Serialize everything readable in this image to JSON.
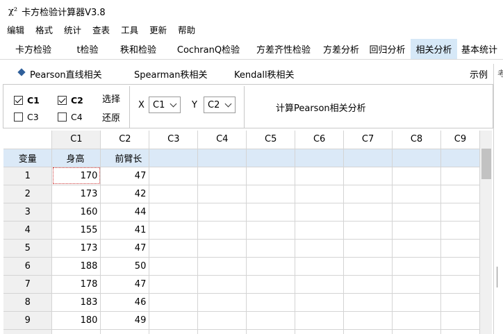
{
  "window": {
    "icon_glyph": "χ²",
    "title": "卡方检验计算器V3.8"
  },
  "menu": [
    "编辑",
    "格式",
    "统计",
    "查表",
    "工具",
    "更新",
    "帮助"
  ],
  "tabs": [
    {
      "label": "卡方检验"
    },
    {
      "label": "t检验"
    },
    {
      "label": "秩和检验"
    },
    {
      "label": "CochranQ检验"
    },
    {
      "label": "方差齐性检验"
    },
    {
      "label": "方差分析"
    },
    {
      "label": "回归分析"
    },
    {
      "label": "相关分析",
      "active": true
    },
    {
      "label": "基本统计"
    }
  ],
  "subtabs": {
    "pearson": "Pearson直线相关",
    "spearman": "Spearman秩相关",
    "kendall": "Kendall秩相关",
    "example": "示例"
  },
  "right_edge_char": "考",
  "columns_panel": {
    "c1": {
      "label": "C1",
      "checked": true
    },
    "c2": {
      "label": "C2",
      "checked": true
    },
    "c3": {
      "label": "C3",
      "checked": false
    },
    "c4": {
      "label": "C4",
      "checked": false
    },
    "select_label": "选择",
    "reset_label": "还原"
  },
  "xy": {
    "x_label": "X",
    "x_value": "C1",
    "y_label": "Y",
    "y_value": "C2"
  },
  "compute_button": "计算Pearson相关分析",
  "grid": {
    "headers": [
      "C1",
      "C2",
      "C3",
      "C4",
      "C5",
      "C6",
      "C7",
      "C8",
      "C9"
    ],
    "var_row": {
      "label": "变量",
      "c1": "身高",
      "c2": "前臂长"
    },
    "rows": [
      {
        "n": "1",
        "c1": "170",
        "c2": "47"
      },
      {
        "n": "2",
        "c1": "173",
        "c2": "42"
      },
      {
        "n": "3",
        "c1": "160",
        "c2": "44"
      },
      {
        "n": "4",
        "c1": "155",
        "c2": "41"
      },
      {
        "n": "5",
        "c1": "173",
        "c2": "47"
      },
      {
        "n": "6",
        "c1": "188",
        "c2": "50"
      },
      {
        "n": "7",
        "c1": "178",
        "c2": "47"
      },
      {
        "n": "8",
        "c1": "183",
        "c2": "46"
      },
      {
        "n": "9",
        "c1": "180",
        "c2": "49"
      }
    ]
  }
}
